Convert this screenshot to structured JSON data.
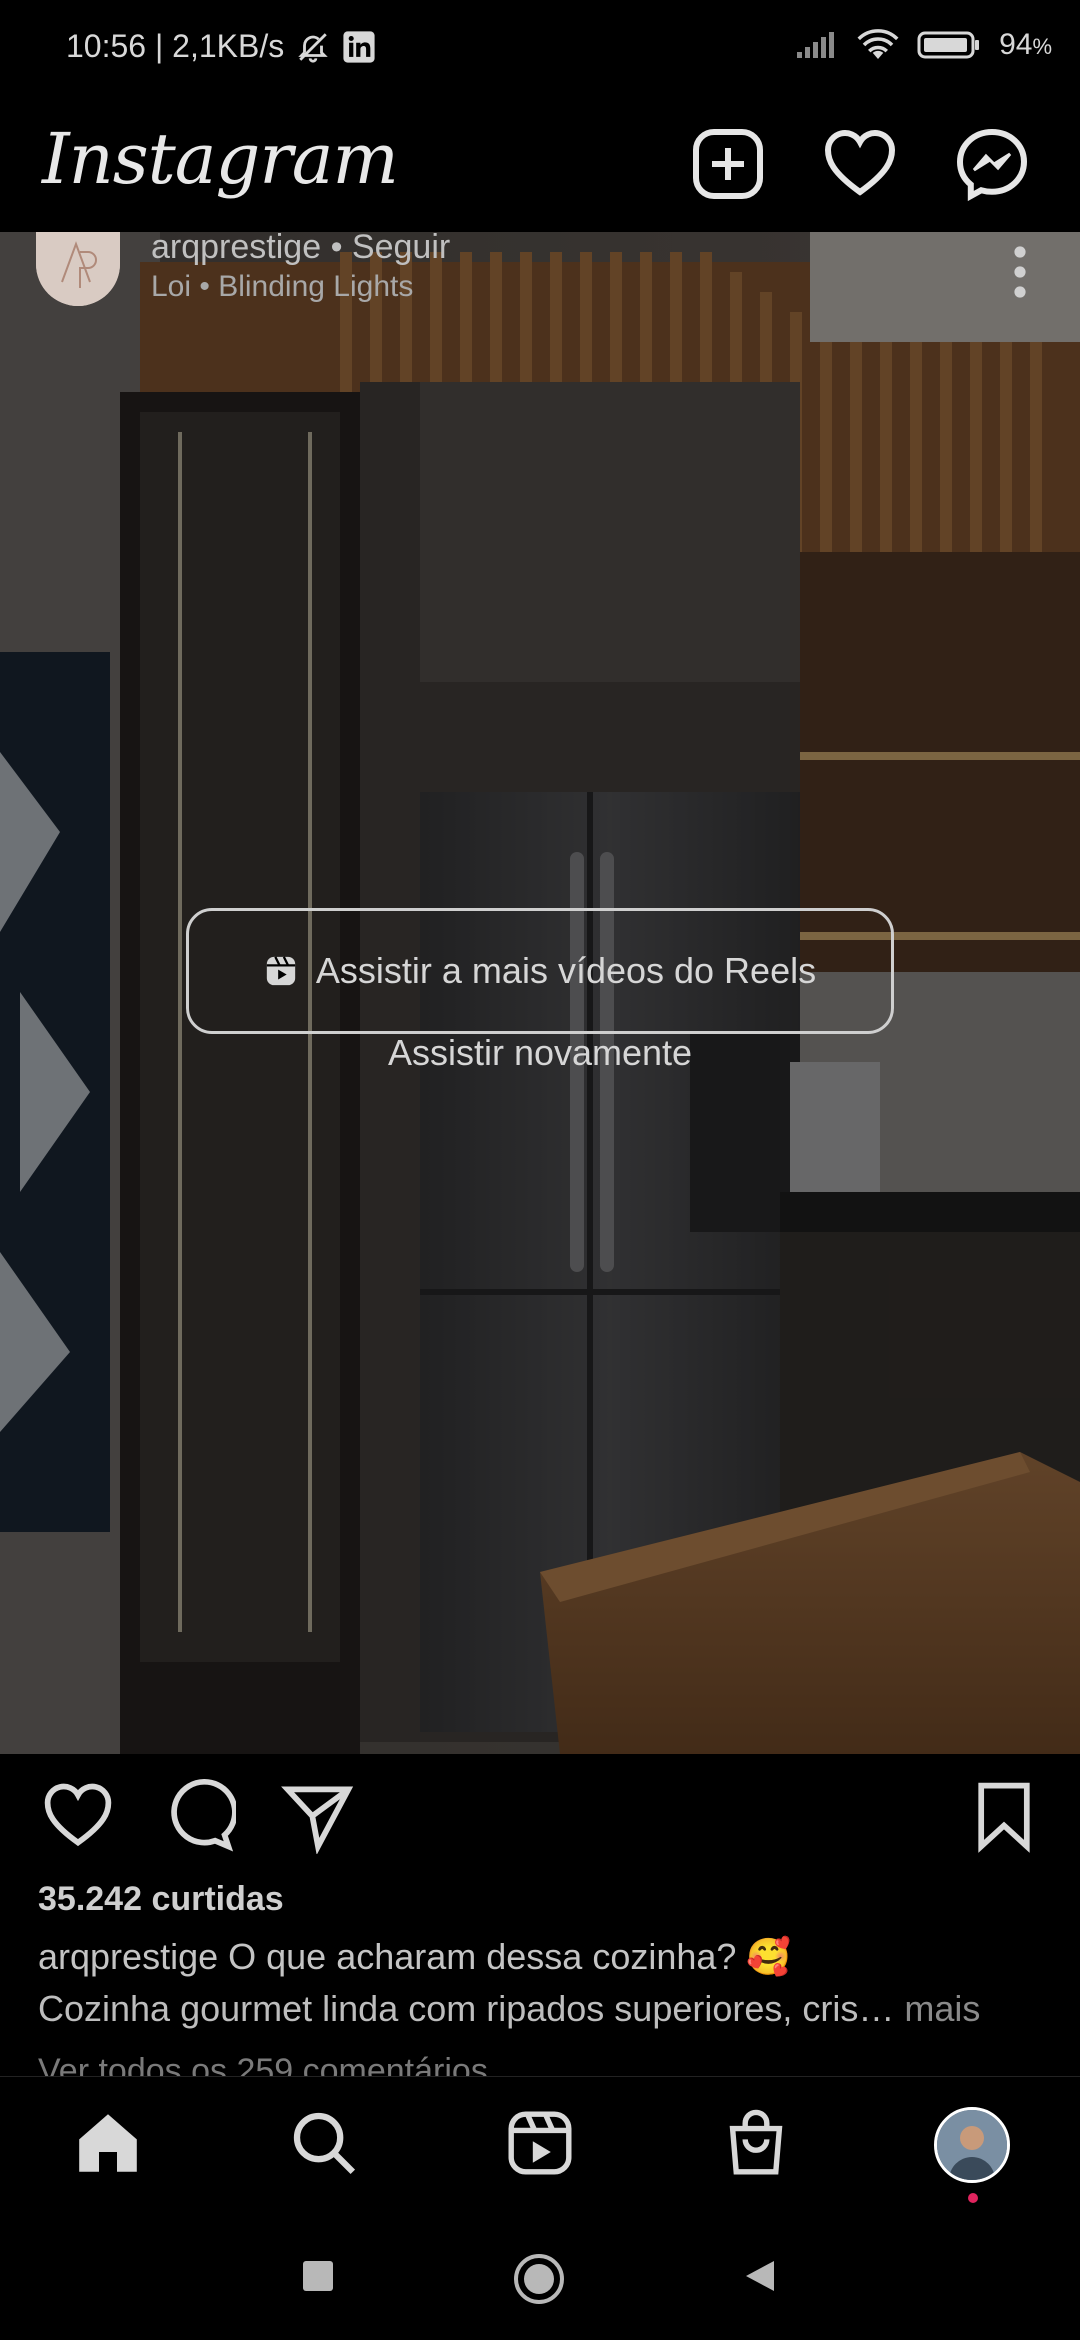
{
  "status_bar": {
    "time": "10:56 | 2,1KB/s",
    "battery": "94",
    "battery_unit": "%"
  },
  "header": {
    "app_name": "Instagram"
  },
  "post": {
    "username": "arqprestige",
    "follow_text": "• Seguir",
    "audio_line": "Loi • Blinding Lights",
    "reels_cta": "Assistir a mais vídeos do Reels",
    "replay": "Assistir novamente",
    "likes": "35.242 curtidas",
    "caption_user": "arqprestige",
    "caption_text": "O que acharam dessa cozinha? 🥰",
    "caption_line2": "Cozinha gourmet linda com ripados superiores, cris…",
    "more_label": " mais",
    "comments_link": "Ver todos os 259 comentários"
  },
  "colors": {
    "background": "#000000",
    "notification_dot": "#e0245e"
  }
}
